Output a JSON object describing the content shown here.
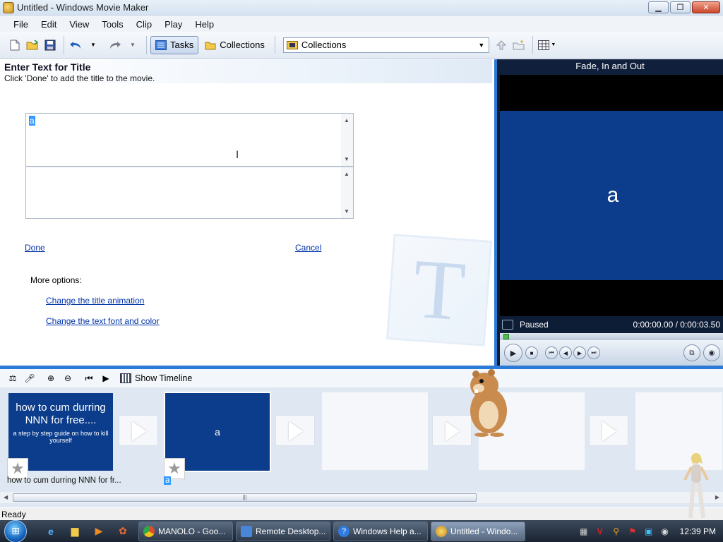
{
  "window": {
    "title": "Untitled - Windows Movie Maker",
    "min_icon": "minimize-icon",
    "max_icon": "restore-icon",
    "close_icon": "close-icon"
  },
  "menu": [
    "File",
    "Edit",
    "View",
    "Tools",
    "Clip",
    "Play",
    "Help"
  ],
  "toolbar": {
    "tasks_label": "Tasks",
    "collections_label": "Collections",
    "collection_select": "Collections"
  },
  "taskpane": {
    "heading": "Enter Text for Title",
    "instruction": "Click 'Done' to add the title to the movie.",
    "title_text": "a",
    "done": "Done",
    "cancel": "Cancel",
    "more_options": "More options:",
    "change_animation": "Change the title animation",
    "change_font": "Change the text font and color"
  },
  "preview": {
    "effect_title": "Fade, In and Out",
    "screen_text": "a",
    "status": "Paused",
    "time": "0:00:00.00 / 0:00:03.50"
  },
  "storyboard": {
    "show_timeline": "Show Timeline",
    "clip1": {
      "big": "how to cum durring NNN for free....",
      "small": "a step by step guide on how to kill yourself",
      "caption": "how to cum durring NNN for fr..."
    },
    "clip2": {
      "text": "a",
      "caption": "a"
    }
  },
  "statusbar": {
    "text": "Ready"
  },
  "taskbar": {
    "tasks": [
      {
        "label": "MANOLO - Goo...",
        "color": "#e04a2f"
      },
      {
        "label": "Remote Desktop...",
        "color": "#4a86d8"
      },
      {
        "label": "Windows Help a...",
        "color": "#2f7be0"
      },
      {
        "label": "Untitled - Windo...",
        "color": "#e0a030"
      }
    ],
    "clock": "12:39 PM"
  }
}
